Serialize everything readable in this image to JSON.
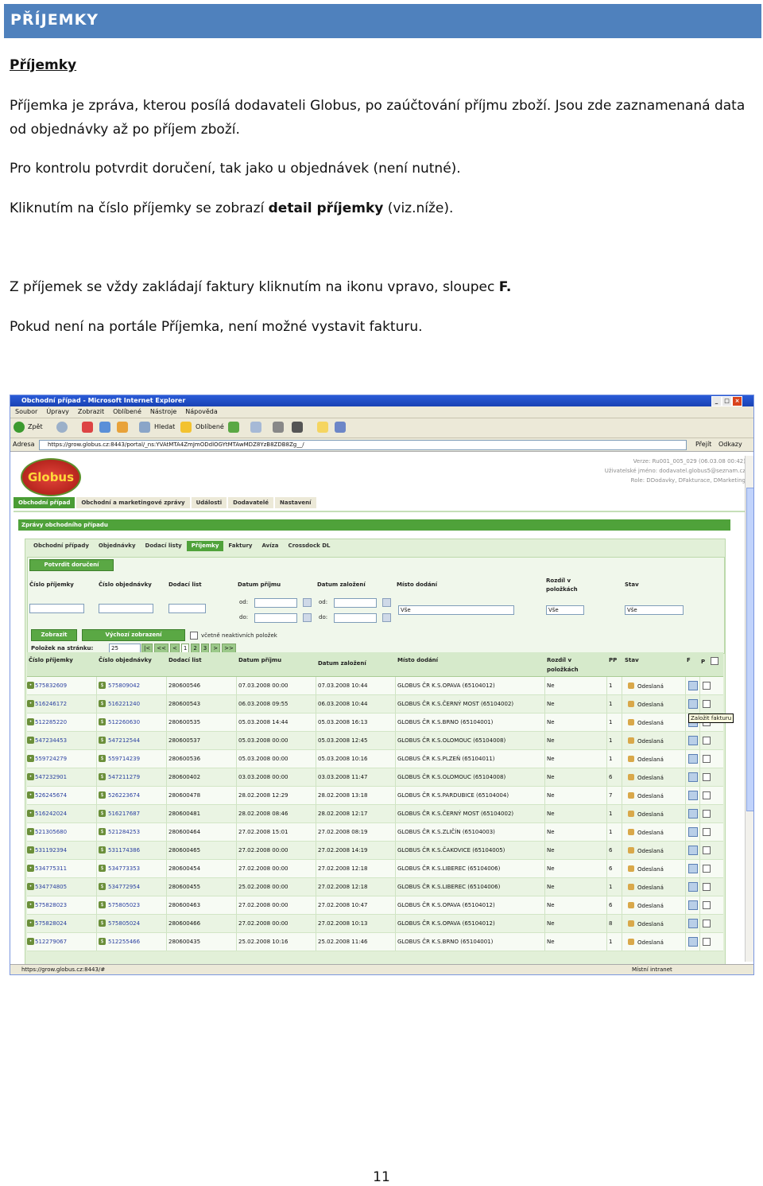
{
  "header": {
    "title": "PŘÍJEMKY"
  },
  "section_title": "Příjemky",
  "paragraphs": {
    "p1": "Příjemka je zpráva, kterou posílá dodavateli Globus, po zaúčtování příjmu zboží. Jsou zde zaznamenaná data od objednávky až po příjem zboží.",
    "p2": "Pro kontrolu potvrdit doručení, tak jako u objednávek (není nutné).",
    "p3_pre": "Kliknutím na číslo příjemky se zobrazí ",
    "p3_bold": "detail příjemky",
    "p3_post": " (viz.níže).",
    "p4_pre": "Z příjemek se vždy zakládají faktury kliknutím na ikonu vpravo, sloupec ",
    "p4_bold": "F.",
    "p5": "Pokud není na portále Příjemka, není možné vystavit fakturu."
  },
  "page_number": "11",
  "browser": {
    "title": "Obchodní případ - Microsoft Internet Explorer",
    "menu": [
      "Soubor",
      "Úpravy",
      "Zobrazit",
      "Oblíbené",
      "Nástroje",
      "Nápověda"
    ],
    "toolbar": {
      "back": "Zpět",
      "search": "Hledat",
      "favorites": "Oblíbené"
    },
    "address_label": "Adresa",
    "address": "https://grow.globus.cz:8443/portal/_ns:YVAtMTA4ZmJmODdlOGYtMTAwMDZ8YzB8ZDB8Zg__/",
    "go": "Přejít",
    "links": "Odkazy",
    "status_url": "https://grow.globus.cz:8443/#",
    "status_zone": "Místní intranet"
  },
  "portal": {
    "logo": "Globus",
    "version": "Verze: Ru001_005_029 (06.03.08 00:42)",
    "username": "Uživatelské jméno: dodavatel.globus5@seznam.cz",
    "role": "Role: DDodavky, DFakturace, DMarketing",
    "tabs": [
      "Obchodní případ",
      "Obchodní a marketingové zprávy",
      "Události",
      "Dodavatelé",
      "Nastavení"
    ],
    "panel_title": "Zprávy obchodního případu",
    "inner_tabs": [
      "Obchodní případy",
      "Objednávky",
      "Dodací listy",
      "Příjemky",
      "Faktury",
      "Avíza",
      "Crossdock DL"
    ],
    "confirm_button": "Potvrdit doručení",
    "filters": {
      "cislo_prijemky": "Číslo příjemky",
      "cislo_objednavky": "Číslo objednávky",
      "dodaci_list": "Dodací list",
      "datum_prijmu": "Datum příjmu",
      "datum_zalozeni": "Datum založení",
      "misto_dodani": "Místo dodání",
      "rozdil": "Rozdíl v položkách",
      "stav": "Stav",
      "od": "od:",
      "do": "do:",
      "vse": "Vše"
    },
    "show_button": "Zobrazit",
    "default_button": "Výchozí zobrazení",
    "include_inactive": "včetně neaktivních položek",
    "per_page_label": "Položek na stránku:",
    "per_page": "25",
    "pager": [
      "|<",
      "<<",
      "<",
      "1",
      "2",
      "3",
      ">",
      ">>"
    ],
    "columns": {
      "c1": "Číslo příjemky",
      "c2": "Číslo objednávky",
      "c3": "Dodací list",
      "c4": "Datum příjmu",
      "c5": "Datum založení",
      "c6": "Místo dodání",
      "c7": "Rozdíl v položkách",
      "c8": "PP",
      "c9": "Stav",
      "c10": "F",
      "c11": "P"
    },
    "tooltip": "Založit fakturu",
    "rows": [
      [
        "575832609",
        "575809042",
        "280600546",
        "07.03.2008 00:00",
        "07.03.2008 10:44",
        "GLOBUS ČR K.S.OPAVA (65104012)",
        "Ne",
        "1",
        "Odeslaná"
      ],
      [
        "516246172",
        "516221240",
        "280600543",
        "06.03.2008 09:55",
        "06.03.2008 10:44",
        "GLOBUS ČR K.S.ČERNÝ MOST (65104002)",
        "Ne",
        "1",
        "Odeslaná"
      ],
      [
        "512285220",
        "512260630",
        "280600535",
        "05.03.2008 14:44",
        "05.03.2008 16:13",
        "GLOBUS ČR K.S.BRNO (65104001)",
        "Ne",
        "1",
        "Odeslaná"
      ],
      [
        "547234453",
        "547212544",
        "280600537",
        "05.03.2008 00:00",
        "05.03.2008 12:45",
        "GLOBUS ČR K.S.OLOMOUC (65104008)",
        "Ne",
        "1",
        "Odeslaná"
      ],
      [
        "559724279",
        "559714239",
        "280600536",
        "05.03.2008 00:00",
        "05.03.2008 10:16",
        "GLOBUS ČR K.S.PLZEŇ (65104011)",
        "Ne",
        "1",
        "Odeslaná"
      ],
      [
        "547232901",
        "547211279",
        "280600402",
        "03.03.2008 00:00",
        "03.03.2008 11:47",
        "GLOBUS ČR K.S.OLOMOUC (65104008)",
        "Ne",
        "6",
        "Odeslaná"
      ],
      [
        "526245674",
        "526223674",
        "280600478",
        "28.02.2008 12:29",
        "28.02.2008 13:18",
        "GLOBUS ČR K.S.PARDUBICE (65104004)",
        "Ne",
        "7",
        "Odeslaná"
      ],
      [
        "516242024",
        "516217687",
        "280600481",
        "28.02.2008 08:46",
        "28.02.2008 12:17",
        "GLOBUS ČR K.S.ČERNÝ MOST (65104002)",
        "Ne",
        "1",
        "Odeslaná"
      ],
      [
        "521305680",
        "521284253",
        "280600464",
        "27.02.2008 15:01",
        "27.02.2008 08:19",
        "GLOBUS ČR K.S.ZLIČÍN (65104003)",
        "Ne",
        "1",
        "Odeslaná"
      ],
      [
        "531192394",
        "531174386",
        "280600465",
        "27.02.2008 00:00",
        "27.02.2008 14:19",
        "GLOBUS ČR K.S.ČAKOVICE (65104005)",
        "Ne",
        "6",
        "Odeslaná"
      ],
      [
        "534775311",
        "534773353",
        "280600454",
        "27.02.2008 00:00",
        "27.02.2008 12:18",
        "GLOBUS ČR K.S.LIBEREC (65104006)",
        "Ne",
        "6",
        "Odeslaná"
      ],
      [
        "534774805",
        "534772954",
        "280600455",
        "25.02.2008 00:00",
        "27.02.2008 12:18",
        "GLOBUS ČR K.S.LIBEREC (65104006)",
        "Ne",
        "1",
        "Odeslaná"
      ],
      [
        "575828023",
        "575805023",
        "280600463",
        "27.02.2008 00:00",
        "27.02.2008 10:47",
        "GLOBUS ČR K.S.OPAVA (65104012)",
        "Ne",
        "6",
        "Odeslaná"
      ],
      [
        "575828024",
        "575805024",
        "280600466",
        "27.02.2008 00:00",
        "27.02.2008 10:13",
        "GLOBUS ČR K.S.OPAVA (65104012)",
        "Ne",
        "8",
        "Odeslaná"
      ],
      [
        "512279067",
        "512255466",
        "280600435",
        "25.02.2008 10:16",
        "25.02.2008 11:46",
        "GLOBUS ČR K.S.BRNO (65104001)",
        "Ne",
        "1",
        "Odeslaná"
      ]
    ]
  }
}
